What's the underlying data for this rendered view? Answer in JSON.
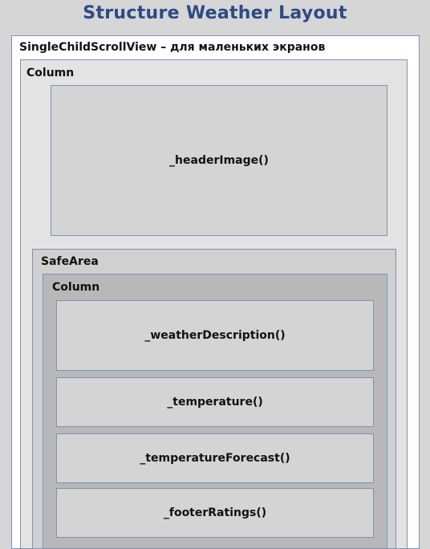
{
  "title": "Structure Weather Layout",
  "outer_label": "SingleChildScrollView – для маленьких экранов",
  "column1_label": "Column",
  "header_image_label": "_headerImage()",
  "safe_area_label": "SafeArea",
  "column2_label": "Column",
  "items": [
    {
      "label": "_weatherDescription()"
    },
    {
      "label": "_temperature()"
    },
    {
      "label": "_temperatureForecast()"
    },
    {
      "label": "_footerRatings()"
    }
  ],
  "colors": {
    "title": "#2c4a86",
    "border": "#7a92b8",
    "background": "#d6d6d6"
  }
}
